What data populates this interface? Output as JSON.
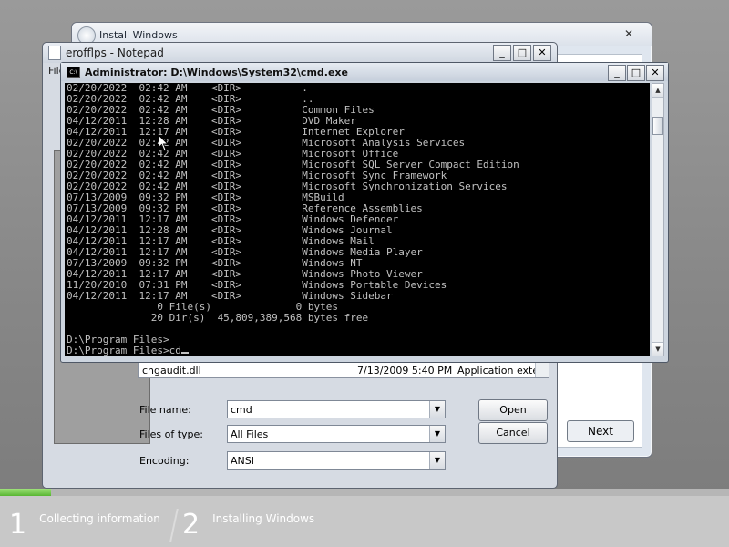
{
  "setup": {
    "title": "Install Windows",
    "next_label": "Next"
  },
  "notepad": {
    "title": "erofflps - Notepad",
    "menu": "File",
    "file_list": {
      "name": "cngaudit.dll",
      "date": "7/13/2009 5:40 PM",
      "type": "Application exte..."
    },
    "filename_label": "File name:",
    "filename_value": "cmd",
    "filetype_label": "Files of type:",
    "filetype_value": "All Files",
    "encoding_label": "Encoding:",
    "encoding_value": "ANSI",
    "open_label": "Open",
    "cancel_label": "Cancel"
  },
  "cmd": {
    "title": "Administrator: D:\\Windows\\System32\\cmd.exe",
    "lines": [
      "02/20/2022  02:42 AM    <DIR>          .",
      "02/20/2022  02:42 AM    <DIR>          ..",
      "02/20/2022  02:42 AM    <DIR>          Common Files",
      "04/12/2011  12:28 AM    <DIR>          DVD Maker",
      "04/12/2011  12:17 AM    <DIR>          Internet Explorer",
      "02/20/2022  02:42 AM    <DIR>          Microsoft Analysis Services",
      "02/20/2022  02:42 AM    <DIR>          Microsoft Office",
      "02/20/2022  02:42 AM    <DIR>          Microsoft SQL Server Compact Edition",
      "02/20/2022  02:42 AM    <DIR>          Microsoft Sync Framework",
      "02/20/2022  02:42 AM    <DIR>          Microsoft Synchronization Services",
      "07/13/2009  09:32 PM    <DIR>          MSBuild",
      "07/13/2009  09:32 PM    <DIR>          Reference Assemblies",
      "04/12/2011  12:17 AM    <DIR>          Windows Defender",
      "04/12/2011  12:28 AM    <DIR>          Windows Journal",
      "04/12/2011  12:17 AM    <DIR>          Windows Mail",
      "04/12/2011  12:17 AM    <DIR>          Windows Media Player",
      "07/13/2009  09:32 PM    <DIR>          Windows NT",
      "04/12/2011  12:17 AM    <DIR>          Windows Photo Viewer",
      "11/20/2010  07:31 PM    <DIR>          Windows Portable Devices",
      "04/12/2011  12:17 AM    <DIR>          Windows Sidebar",
      "               0 File(s)              0 bytes",
      "              20 Dir(s)  45,809,389,568 bytes free",
      "",
      "D:\\Program Files>",
      "D:\\Program Files>cd"
    ]
  },
  "footer": {
    "progress_fraction": 0.07,
    "steps": [
      {
        "number": "1",
        "label": "Collecting information"
      },
      {
        "number": "2",
        "label": "Installing Windows"
      }
    ]
  },
  "colors": {
    "cmd_text": "#c0c0c0",
    "cmd_bg": "#000000",
    "progress_green": "#58b531"
  }
}
